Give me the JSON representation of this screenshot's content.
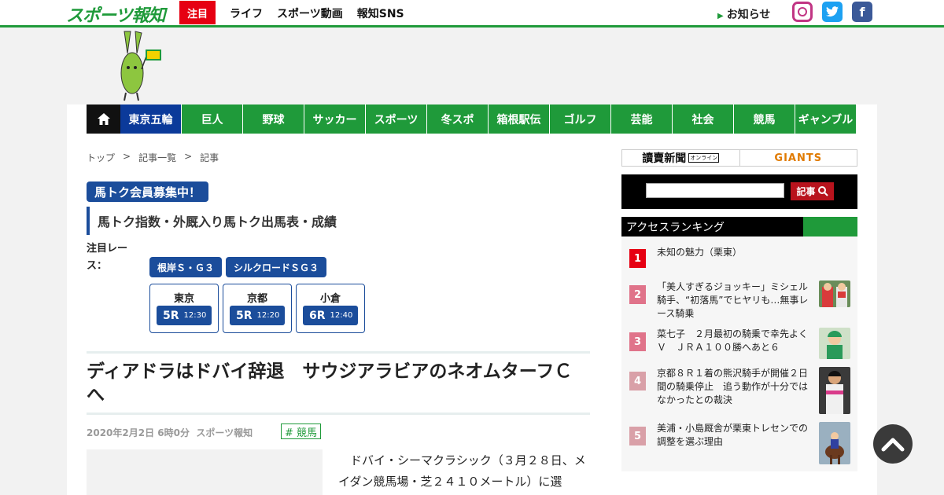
{
  "header": {
    "logo": "スポーツ報知",
    "focus": "注目",
    "nav": [
      "ライフ",
      "スポーツ動画",
      "報知SNS"
    ],
    "notice": "お知らせ",
    "sns": [
      "instagram-icon",
      "twitter-icon",
      "facebook-icon"
    ]
  },
  "categories": [
    "東京五輪",
    "巨人",
    "野球",
    "サッカー",
    "スポーツ",
    "冬スポ",
    "箱根駅伝",
    "ゴルフ",
    "芸能",
    "社会",
    "競馬",
    "ギャンブル"
  ],
  "breadcrumb": [
    "トップ",
    "記事一覧",
    "記事"
  ],
  "breadcrumb_sep": ">",
  "umatoku": {
    "badge": "馬トク会員募集中！",
    "line": "馬トク指数・外厩入り馬トク出馬表・成績",
    "race_label": "注目レース：",
    "races": [
      "根岸Ｓ・Ｇ３",
      "シルクロードＳＧ３"
    ],
    "venues": [
      {
        "name": "東京",
        "race": "5R",
        "time": "12:30"
      },
      {
        "name": "京都",
        "race": "5R",
        "time": "12:20"
      },
      {
        "name": "小倉",
        "race": "6R",
        "time": "12:40"
      }
    ]
  },
  "article": {
    "title": "ディアドラはドバイ辞退　サウジアラビアのネオムターフＣへ",
    "date": "2020年2月2日 6時0分",
    "source": "スポーツ報知",
    "tag": "# 競馬",
    "body": "ドバイ・シーマクラシック（３月２８日、メイダン競馬場・芝２４１０メートル）に選"
  },
  "sidebar": {
    "partner_left": "讀賣新聞",
    "partner_left_sub": "オンライン",
    "partner_right": "GIANTS",
    "search_placeholder": "",
    "search_btn": "記事",
    "ranking_title": "アクセスランキング",
    "ranking": [
      {
        "rank": "1",
        "title": "未知の魅力（栗東）",
        "color": "#e60012"
      },
      {
        "rank": "2",
        "title": "「美人すぎるジョッキー」ミシェル騎手、“初落馬”でヒヤリも…無事レース騎乗",
        "color": "#e0738a"
      },
      {
        "rank": "3",
        "title": "菜七子　２月最初の騎乗で幸先よくＶ　ＪＲＡ１００勝へあと６",
        "color": "#e0738a"
      },
      {
        "rank": "4",
        "title": "京都８Ｒ１着の熊沢騎手が開催２日間の騎乗停止　追う動作が十分ではなかったとの裁決",
        "color": "#d9a0a8"
      },
      {
        "rank": "5",
        "title": "美浦・小島厩舎が栗東トレセンでの調整を選ぶ理由",
        "color": "#d9a0a8"
      }
    ]
  }
}
